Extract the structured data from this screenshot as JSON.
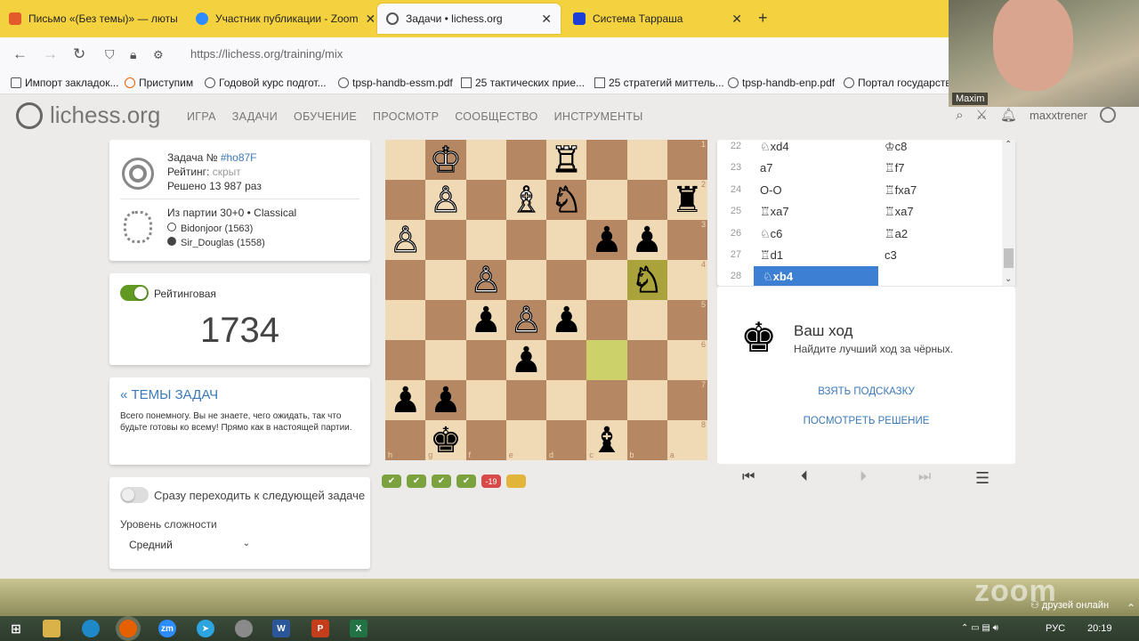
{
  "browser": {
    "tabs": [
      {
        "title": "Письмо «(Без темы)» — люты",
        "icon": "heart-mail-icon",
        "color": "#e35b2a"
      },
      {
        "title": "Участник публикации - Zoom",
        "icon": "zoom-icon",
        "color": "#2d8cff"
      },
      {
        "title": "Задачи • lichess.org",
        "icon": "lichess-icon",
        "color": "#555555"
      },
      {
        "title": "Система Тарраша",
        "icon": "blue-square-icon",
        "color": "#1b3fd6"
      }
    ],
    "url": "https://lichess.org/training/mix",
    "bookmarks": [
      "Импорт закладок...",
      "Приступим",
      "Годовой курс подгот...",
      "tpsp-handb-essm.pdf",
      "25 тактических прие...",
      "25 стратегий миттель...",
      "tpsp-handb-enp.pdf",
      "Портал государстве"
    ]
  },
  "site": {
    "logo": "lichess.org",
    "menu": [
      "ИГРА",
      "ЗАДАЧИ",
      "ОБУЧЕНИЕ",
      "ПРОСМОТР",
      "СООБЩЕСТВО",
      "ИНСТРУМЕНТЫ"
    ],
    "user": "maxxtrener"
  },
  "puzzle": {
    "label": "Задача №",
    "id": "#ho87F",
    "rating_label": "Рейтинг:",
    "rating_value": "скрыт",
    "solved": "Решено 13 987 раз",
    "game": "Из партии 30+0 • Classical",
    "white_player": "Bidonjoor (1563)",
    "black_player": "Sir_Douglas (1558)"
  },
  "rating": {
    "toggle_label": "Рейтинговая",
    "value": "1734"
  },
  "themes": {
    "title": "« ТЕМЫ ЗАДАЧ",
    "desc": "Всего понемногу. Вы не знаете, чего ожидать, так что будьте готовы ко всему! Прямо как в настоящей партии."
  },
  "settings": {
    "auto_next_label": "Сразу переходить к следующей задаче",
    "difficulty_label": "Уровень сложности",
    "difficulty_value": "Средний"
  },
  "board": {
    "ranks": [
      "1",
      "2",
      "3",
      "4",
      "5",
      "6",
      "7",
      "8"
    ],
    "files": [
      "h",
      "g",
      "f",
      "e",
      "d",
      "c",
      "b",
      "a"
    ],
    "rows": [
      [
        "",
        "♔w",
        "",
        "",
        "♖w",
        "",
        "",
        ""
      ],
      [
        "",
        "♙w",
        "",
        "♗w",
        "♘w",
        "",
        "",
        "♜b"
      ],
      [
        "♙w",
        "",
        "",
        "",
        "",
        "♟b",
        "♟b",
        ""
      ],
      [
        "",
        "",
        "♙w",
        "",
        "",
        "",
        "♘w",
        ""
      ],
      [
        "",
        "",
        "♟b",
        "♙w",
        "♟b",
        "",
        "",
        ""
      ],
      [
        "",
        "",
        "",
        "♟b",
        "",
        "",
        "",
        ""
      ],
      [
        "♟b",
        "♟b",
        "",
        "",
        "",
        "",
        "",
        ""
      ],
      [
        "",
        "♚b",
        "",
        "",
        "",
        "♝b",
        "",
        ""
      ]
    ],
    "highlights": [
      "3-6",
      "5-5"
    ]
  },
  "streak": [
    "✔",
    "✔",
    "✔",
    "✔",
    "-19",
    ""
  ],
  "moves": [
    {
      "n": "22",
      "w": "♘xd4",
      "b": "♔c8"
    },
    {
      "n": "23",
      "w": "a7",
      "b": "♖f7"
    },
    {
      "n": "24",
      "w": "O-O",
      "b": "♖fxa7"
    },
    {
      "n": "25",
      "w": "♖xa7",
      "b": "♖xa7"
    },
    {
      "n": "26",
      "w": "♘c6",
      "b": "♖a2"
    },
    {
      "n": "27",
      "w": "♖d1",
      "b": "c3"
    },
    {
      "n": "28",
      "w": "♘xb4",
      "b": ""
    }
  ],
  "yourmove": {
    "title": "Ваш ход",
    "subtitle": "Найдите лучший ход за чёрных.",
    "hint": "ВЗЯТЬ ПОДСКАЗКУ",
    "solution": "ПОСМОТРЕТЬ РЕШЕНИЕ"
  },
  "camera": {
    "name": "Maxim"
  },
  "zoom": {
    "watermark": "zoom",
    "online": "друзей онлайн"
  },
  "taskbar": {
    "lang": "РУС",
    "time": "20:19"
  }
}
